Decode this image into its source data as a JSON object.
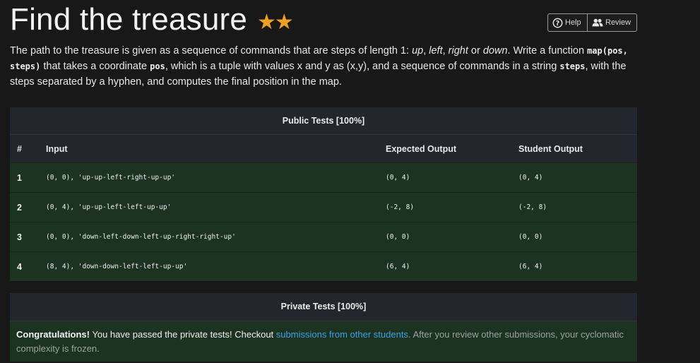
{
  "header": {
    "title": "Find the treasure",
    "stars": "★★",
    "help_label": "Help",
    "review_label": "Review"
  },
  "description": {
    "p1": "The path to the treasure is given as a sequence of commands that are steps of length 1: ",
    "w_up": "up",
    "sep1": ", ",
    "w_left": "left",
    "sep2": ", ",
    "w_right": "right",
    "sep3": " or ",
    "w_down": "down",
    "p2": ". Write a function ",
    "code_fn": "map(pos, steps)",
    "p3": " that takes a coordinate ",
    "code_pos": "pos",
    "p4": ", which is a tuple with values x and y as (x,y), and a sequence of commands in a string ",
    "code_steps": "steps",
    "p5": ", with the steps separated by a hyphen, and computes the final position in the map."
  },
  "public_tests": {
    "title": "Public Tests [100%]",
    "columns": [
      "#",
      "Input",
      "Expected Output",
      "Student Output"
    ],
    "rows": [
      {
        "num": "1",
        "input": "(0, 0), 'up-up-left-right-up-up'",
        "expected": "(0, 4)",
        "student": "(0, 4)"
      },
      {
        "num": "2",
        "input": "(0, 4), 'up-up-left-left-up-up'",
        "expected": "(-2, 8)",
        "student": "(-2, 8)"
      },
      {
        "num": "3",
        "input": "(0, 0), 'down-left-down-left-up-right-right-up'",
        "expected": "(0, 0)",
        "student": "(0, 0)"
      },
      {
        "num": "4",
        "input": "(8, 4), 'down-down-left-left-up-up'",
        "expected": "(6, 4)",
        "student": "(6, 4)"
      }
    ]
  },
  "private_tests": {
    "title": "Private Tests [100%]",
    "congrats": "Congratulations!",
    "msg1": " You have passed the private tests! Checkout ",
    "link": "submissions from other students",
    "msg2": ". After you review other submissions, your cyclomatic complexity is frozen."
  },
  "colors": {
    "background": "#181818",
    "pass_row": "#1d3322",
    "header_bg": "#22272e",
    "star": "#f0a020",
    "link": "#3d9ee6"
  },
  "icons": [
    "question-circle-icon",
    "users-icon"
  ]
}
